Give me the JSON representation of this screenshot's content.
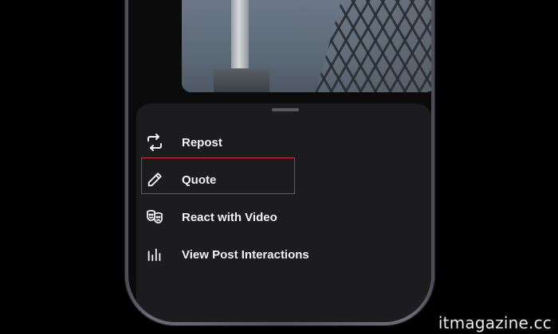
{
  "sheet": {
    "items": [
      {
        "label": "Repost",
        "icon": "repost-icon"
      },
      {
        "label": "Quote",
        "icon": "pencil-icon"
      },
      {
        "label": "React with Video",
        "icon": "theater-masks-icon"
      },
      {
        "label": "View Post Interactions",
        "icon": "bar-chart-icon"
      }
    ],
    "highlighted_item": "React with Video"
  },
  "colors": {
    "background": "#000000",
    "sheet": "#1c1c1e",
    "text": "#f2f2f2",
    "highlight": "#d62c34"
  },
  "watermark": {
    "text": "itmagazine.cc"
  }
}
